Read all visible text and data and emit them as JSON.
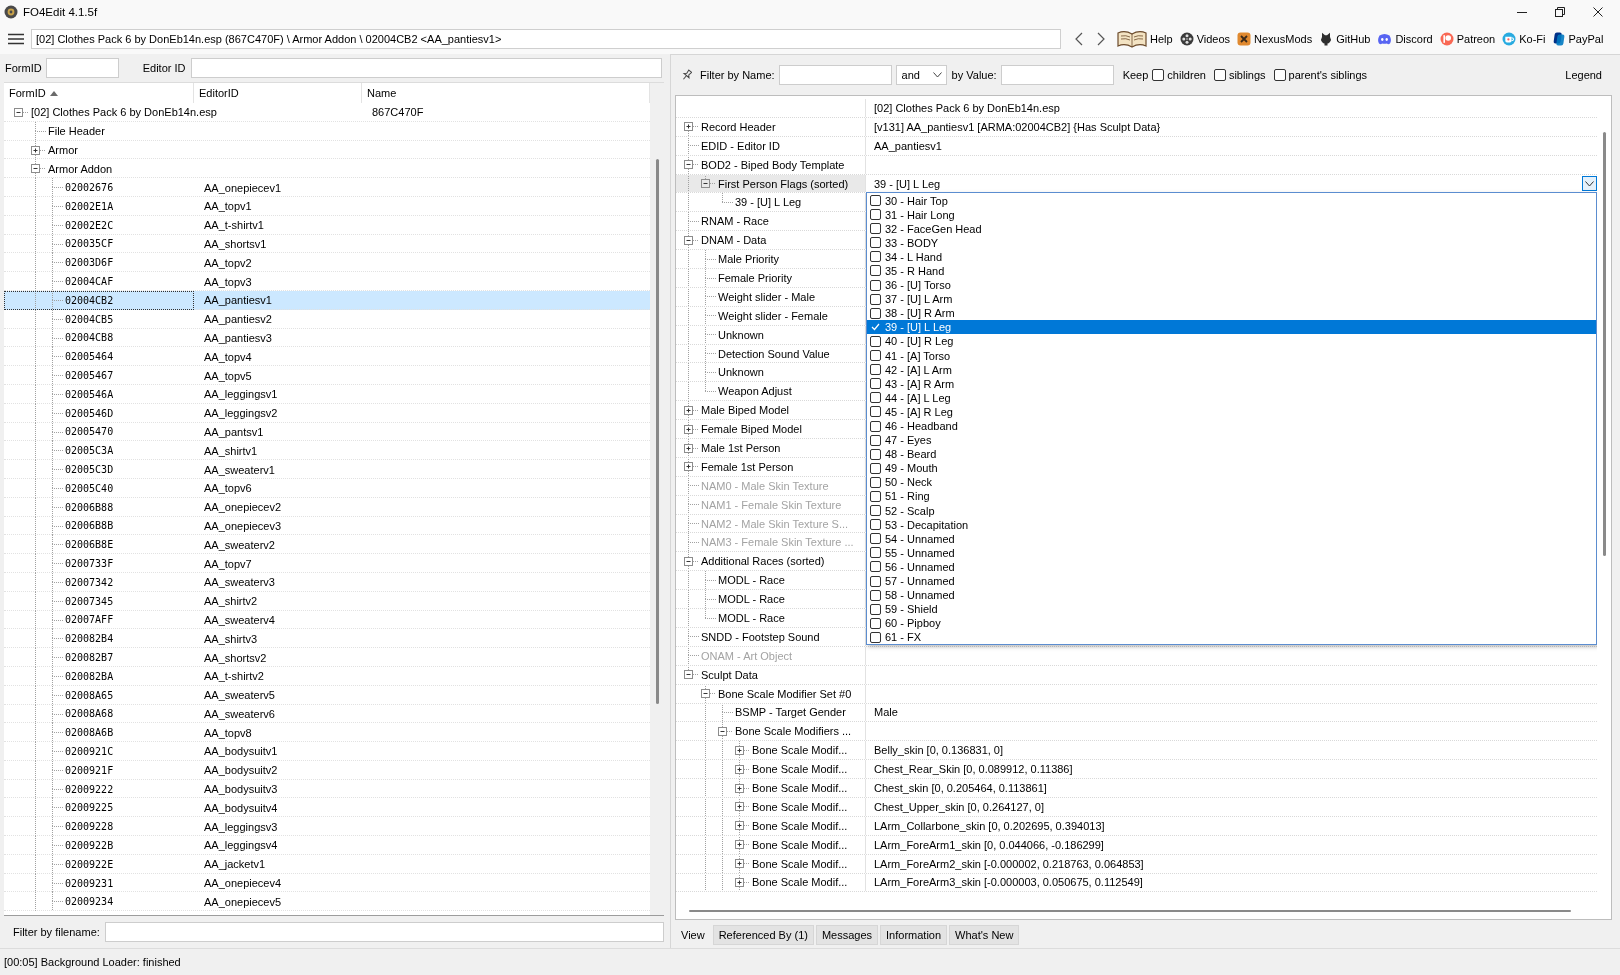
{
  "window": {
    "title": "FO4Edit 4.1.5f"
  },
  "navbar": {
    "path": "[02] Clothes Pack 6 by DonEb14n.esp (867C470F) \\ Armor Addon \\ 02004CB2 <AA_pantiesv1>",
    "links": [
      "Help",
      "Videos",
      "NexusMods",
      "GitHub",
      "Discord",
      "Patreon",
      "Ko-Fi",
      "PayPal"
    ]
  },
  "left_panel": {
    "formid_label": "FormID",
    "editorid_label": "Editor ID",
    "columns": [
      {
        "label": "FormID",
        "sorted": true
      },
      {
        "label": "EditorID",
        "sorted": false
      },
      {
        "label": "Name",
        "sorted": false
      }
    ],
    "tree": [
      {
        "kind": "file",
        "formid": "[02] Clothes Pack 6 by DonEb14n.esp",
        "name": "867C470F",
        "expanded": true,
        "selected": false,
        "children": [
          {
            "kind": "group",
            "formid": "File Header",
            "selected": false
          },
          {
            "kind": "group",
            "formid": "Armor",
            "expanded": false,
            "selected": false
          },
          {
            "kind": "group",
            "formid": "Armor Addon",
            "expanded": true,
            "selected": false,
            "children": [
              {
                "kind": "record",
                "formid": "02002676",
                "editorid": "AA_onepiecev1",
                "selected": false
              },
              {
                "kind": "record",
                "formid": "02002E1A",
                "editorid": "AA_topv1",
                "selected": false
              },
              {
                "kind": "record",
                "formid": "02002E2C",
                "editorid": "AA_t-shirtv1",
                "selected": false
              },
              {
                "kind": "record",
                "formid": "020035CF",
                "editorid": "AA_shortsv1",
                "selected": false
              },
              {
                "kind": "record",
                "formid": "02003D6F",
                "editorid": "AA_topv2",
                "selected": false
              },
              {
                "kind": "record",
                "formid": "02004CAF",
                "editorid": "AA_topv3",
                "selected": false
              },
              {
                "kind": "record",
                "formid": "02004CB2",
                "editorid": "AA_pantiesv1",
                "selected": true
              },
              {
                "kind": "record",
                "formid": "02004CB5",
                "editorid": "AA_pantiesv2",
                "selected": false
              },
              {
                "kind": "record",
                "formid": "02004CB8",
                "editorid": "AA_pantiesv3",
                "selected": false
              },
              {
                "kind": "record",
                "formid": "02005464",
                "editorid": "AA_topv4",
                "selected": false
              },
              {
                "kind": "record",
                "formid": "02005467",
                "editorid": "AA_topv5",
                "selected": false
              },
              {
                "kind": "record",
                "formid": "0200546A",
                "editorid": "AA_leggingsv1",
                "selected": false
              },
              {
                "kind": "record",
                "formid": "0200546D",
                "editorid": "AA_leggingsv2",
                "selected": false
              },
              {
                "kind": "record",
                "formid": "02005470",
                "editorid": "AA_pantsv1",
                "selected": false
              },
              {
                "kind": "record",
                "formid": "02005C3A",
                "editorid": "AA_shirtv1",
                "selected": false
              },
              {
                "kind": "record",
                "formid": "02005C3D",
                "editorid": "AA_sweaterv1",
                "selected": false
              },
              {
                "kind": "record",
                "formid": "02005C40",
                "editorid": "AA_topv6",
                "selected": false
              },
              {
                "kind": "record",
                "formid": "02006B88",
                "editorid": "AA_onepiecev2",
                "selected": false
              },
              {
                "kind": "record",
                "formid": "02006B8B",
                "editorid": "AA_onepiecev3",
                "selected": false
              },
              {
                "kind": "record",
                "formid": "02006B8E",
                "editorid": "AA_sweaterv2",
                "selected": false
              },
              {
                "kind": "record",
                "formid": "0200733F",
                "editorid": "AA_topv7",
                "selected": false
              },
              {
                "kind": "record",
                "formid": "02007342",
                "editorid": "AA_sweaterv3",
                "selected": false
              },
              {
                "kind": "record",
                "formid": "02007345",
                "editorid": "AA_shirtv2",
                "selected": false
              },
              {
                "kind": "record",
                "formid": "02007AFF",
                "editorid": "AA_sweaterv4",
                "selected": false
              },
              {
                "kind": "record",
                "formid": "020082B4",
                "editorid": "AA_shirtv3",
                "selected": false
              },
              {
                "kind": "record",
                "formid": "020082B7",
                "editorid": "AA_shortsv2",
                "selected": false
              },
              {
                "kind": "record",
                "formid": "020082BA",
                "editorid": "AA_t-shirtv2",
                "selected": false
              },
              {
                "kind": "record",
                "formid": "02008A65",
                "editorid": "AA_sweaterv5",
                "selected": false
              },
              {
                "kind": "record",
                "formid": "02008A68",
                "editorid": "AA_sweaterv6",
                "selected": false
              },
              {
                "kind": "record",
                "formid": "02008A6B",
                "editorid": "AA_topv8",
                "selected": false
              },
              {
                "kind": "record",
                "formid": "0200921C",
                "editorid": "AA_bodysuitv1",
                "selected": false
              },
              {
                "kind": "record",
                "formid": "0200921F",
                "editorid": "AA_bodysuitv2",
                "selected": false
              },
              {
                "kind": "record",
                "formid": "02009222",
                "editorid": "AA_bodysuitv3",
                "selected": false
              },
              {
                "kind": "record",
                "formid": "02009225",
                "editorid": "AA_bodysuitv4",
                "selected": false
              },
              {
                "kind": "record",
                "formid": "02009228",
                "editorid": "AA_leggingsv3",
                "selected": false
              },
              {
                "kind": "record",
                "formid": "0200922B",
                "editorid": "AA_leggingsv4",
                "selected": false
              },
              {
                "kind": "record",
                "formid": "0200922E",
                "editorid": "AA_jacketv1",
                "selected": false
              },
              {
                "kind": "record",
                "formid": "02009231",
                "editorid": "AA_onepiecev4",
                "selected": false
              },
              {
                "kind": "record",
                "formid": "02009234",
                "editorid": "AA_onepiecev5",
                "selected": false
              }
            ]
          }
        ]
      }
    ],
    "filename_filter_label": "Filter by filename:"
  },
  "right_panel": {
    "filter_bar": {
      "name_label": "Filter by Name:",
      "operator": "and",
      "value_label": "by Value:",
      "keep_label": "Keep",
      "keep_options": [
        {
          "label": "children",
          "checked": false
        },
        {
          "label": "siblings",
          "checked": false
        },
        {
          "label": "parent's siblings",
          "checked": false
        }
      ],
      "legend": "Legend"
    },
    "record_view": {
      "file": "[02] Clothes Pack 6 by DonEb14n.esp",
      "rows": [
        {
          "label": "Record Header",
          "value": "[v131] AA_pantiesv1 [ARMA:02004CB2] {Has Sculpt Data}",
          "expanded": false,
          "selected": false,
          "disabled": false
        },
        {
          "label": "EDID - Editor ID",
          "value": "AA_pantiesv1",
          "selected": false,
          "disabled": false
        },
        {
          "label": "BOD2 - Biped Body Template",
          "expanded": true,
          "selected": false,
          "disabled": false,
          "children": [
            {
              "label": "First Person Flags (sorted)",
              "expanded": true,
              "selected": true,
              "disabled": false,
              "editor": {
                "value": "39 - [U] L Leg",
                "open": true,
                "options": [
                  {
                    "label": "30 - Hair Top",
                    "checked": false,
                    "selected": false
                  },
                  {
                    "label": "31 - Hair Long",
                    "checked": false,
                    "selected": false
                  },
                  {
                    "label": "32 - FaceGen Head",
                    "checked": false,
                    "selected": false
                  },
                  {
                    "label": "33 - BODY",
                    "checked": false,
                    "selected": false
                  },
                  {
                    "label": "34 - L Hand",
                    "checked": false,
                    "selected": false
                  },
                  {
                    "label": "35 - R Hand",
                    "checked": false,
                    "selected": false
                  },
                  {
                    "label": "36 - [U] Torso",
                    "checked": false,
                    "selected": false
                  },
                  {
                    "label": "37 - [U] L Arm",
                    "checked": false,
                    "selected": false
                  },
                  {
                    "label": "38 - [U] R Arm",
                    "checked": false,
                    "selected": false
                  },
                  {
                    "label": "39 - [U] L Leg",
                    "checked": true,
                    "selected": true
                  },
                  {
                    "label": "40 - [U] R Leg",
                    "checked": false,
                    "selected": false
                  },
                  {
                    "label": "41 - [A] Torso",
                    "checked": false,
                    "selected": false
                  },
                  {
                    "label": "42 - [A] L Arm",
                    "checked": false,
                    "selected": false
                  },
                  {
                    "label": "43 - [A] R Arm",
                    "checked": false,
                    "selected": false
                  },
                  {
                    "label": "44 - [A] L Leg",
                    "checked": false,
                    "selected": false
                  },
                  {
                    "label": "45 - [A] R Leg",
                    "checked": false,
                    "selected": false
                  },
                  {
                    "label": "46 - Headband",
                    "checked": false,
                    "selected": false
                  },
                  {
                    "label": "47 - Eyes",
                    "checked": false,
                    "selected": false
                  },
                  {
                    "label": "48 - Beard",
                    "checked": false,
                    "selected": false
                  },
                  {
                    "label": "49 - Mouth",
                    "checked": false,
                    "selected": false
                  },
                  {
                    "label": "50 - Neck",
                    "checked": false,
                    "selected": false
                  },
                  {
                    "label": "51 - Ring",
                    "checked": false,
                    "selected": false
                  },
                  {
                    "label": "52 - Scalp",
                    "checked": false,
                    "selected": false
                  },
                  {
                    "label": "53 - Decapitation",
                    "checked": false,
                    "selected": false
                  },
                  {
                    "label": "54 - Unnamed",
                    "checked": false,
                    "selected": false
                  },
                  {
                    "label": "55 - Unnamed",
                    "checked": false,
                    "selected": false
                  },
                  {
                    "label": "56 - Unnamed",
                    "checked": false,
                    "selected": false
                  },
                  {
                    "label": "57 - Unnamed",
                    "checked": false,
                    "selected": false
                  },
                  {
                    "label": "58 - Unnamed",
                    "checked": false,
                    "selected": false
                  },
                  {
                    "label": "59 - Shield",
                    "checked": false,
                    "selected": false
                  },
                  {
                    "label": "60 - Pipboy",
                    "checked": false,
                    "selected": false
                  },
                  {
                    "label": "61 - FX",
                    "checked": false,
                    "selected": false
                  }
                ]
              },
              "children": [
                {
                  "label": "39 - [U] L Leg",
                  "selected": false,
                  "disabled": false
                }
              ]
            }
          ]
        },
        {
          "label": "RNAM - Race",
          "selected": false,
          "disabled": false
        },
        {
          "label": "DNAM - Data",
          "expanded": true,
          "selected": false,
          "disabled": false,
          "children": [
            {
              "label": "Male Priority",
              "selected": false,
              "disabled": false
            },
            {
              "label": "Female Priority",
              "selected": false,
              "disabled": false
            },
            {
              "label": "Weight slider - Male",
              "selected": false,
              "disabled": false
            },
            {
              "label": "Weight slider - Female",
              "selected": false,
              "disabled": false
            },
            {
              "label": "Unknown",
              "selected": false,
              "disabled": false
            },
            {
              "label": "Detection Sound Value",
              "selected": false,
              "disabled": false
            },
            {
              "label": "Unknown",
              "selected": false,
              "disabled": false
            },
            {
              "label": "Weapon Adjust",
              "selected": false,
              "disabled": false
            }
          ]
        },
        {
          "label": "Male Biped Model",
          "expanded": false,
          "selected": false,
          "disabled": false
        },
        {
          "label": "Female Biped Model",
          "expanded": false,
          "selected": false,
          "disabled": false
        },
        {
          "label": "Male 1st Person",
          "expanded": false,
          "selected": false,
          "disabled": false
        },
        {
          "label": "Female 1st Person",
          "expanded": false,
          "selected": false,
          "disabled": false
        },
        {
          "label": "NAM0 - Male Skin Texture",
          "selected": false,
          "disabled": true
        },
        {
          "label": "NAM1 - Female Skin Texture",
          "selected": false,
          "disabled": true
        },
        {
          "label": "NAM2 - Male Skin Texture S...",
          "selected": false,
          "disabled": true
        },
        {
          "label": "NAM3 - Female Skin Texture ...",
          "selected": false,
          "disabled": true
        },
        {
          "label": "Additional Races (sorted)",
          "expanded": true,
          "selected": false,
          "disabled": false,
          "children": [
            {
              "label": "MODL - Race",
              "selected": false,
              "disabled": false
            },
            {
              "label": "MODL - Race",
              "selected": false,
              "disabled": false
            },
            {
              "label": "MODL - Race",
              "selected": false,
              "disabled": false
            }
          ]
        },
        {
          "label": "SNDD - Footstep Sound",
          "selected": false,
          "disabled": false
        },
        {
          "label": "ONAM - Art Object",
          "selected": false,
          "disabled": true
        },
        {
          "label": "Sculpt Data",
          "expanded": true,
          "selected": false,
          "disabled": false,
          "children": [
            {
              "label": "Bone Scale Modifier Set #0",
              "expanded": true,
              "selected": false,
              "disabled": false,
              "children": [
                {
                  "label": "BSMP - Target Gender",
                  "value": "Male",
                  "selected": false,
                  "disabled": false
                },
                {
                  "label": "Bone Scale Modifiers ...",
                  "expanded": true,
                  "selected": false,
                  "disabled": false,
                  "children": [
                    {
                      "label": "Bone Scale Modif...",
                      "value": "Belly_skin [0, 0.136831, 0]",
                      "expanded": false,
                      "selected": false,
                      "disabled": false
                    },
                    {
                      "label": "Bone Scale Modif...",
                      "value": "Chest_Rear_Skin [0, 0.089912, 0.11386]",
                      "expanded": false,
                      "selected": false,
                      "disabled": false
                    },
                    {
                      "label": "Bone Scale Modif...",
                      "value": "Chest_skin [0, 0.205464, 0.113861]",
                      "expanded": false,
                      "selected": false,
                      "disabled": false
                    },
                    {
                      "label": "Bone Scale Modif...",
                      "value": "Chest_Upper_skin [0, 0.264127, 0]",
                      "expanded": false,
                      "selected": false,
                      "disabled": false
                    },
                    {
                      "label": "Bone Scale Modif...",
                      "value": "LArm_Collarbone_skin [0, 0.202695, 0.394013]",
                      "expanded": false,
                      "selected": false,
                      "disabled": false
                    },
                    {
                      "label": "Bone Scale Modif...",
                      "value": "LArm_ForeArm1_skin [0, 0.044066, -0.186299]",
                      "expanded": false,
                      "selected": false,
                      "disabled": false
                    },
                    {
                      "label": "Bone Scale Modif...",
                      "value": "LArm_ForeArm2_skin [-0.000002, 0.218763, 0.064853]",
                      "expanded": false,
                      "selected": false,
                      "disabled": false
                    },
                    {
                      "label": "Bone Scale Modif...",
                      "value": "LArm_ForeArm3_skin [-0.000003, 0.050675, 0.112549]",
                      "expanded": false,
                      "selected": false,
                      "disabled": false
                    }
                  ]
                }
              ]
            }
          ]
        }
      ]
    },
    "tabs": [
      {
        "label": "View",
        "selected": true
      },
      {
        "label": "Referenced By (1)",
        "selected": false
      },
      {
        "label": "Messages",
        "selected": false
      },
      {
        "label": "Information",
        "selected": false
      },
      {
        "label": "What's New",
        "selected": false
      }
    ]
  },
  "status_bar": "[00:05] Background Loader: finished"
}
